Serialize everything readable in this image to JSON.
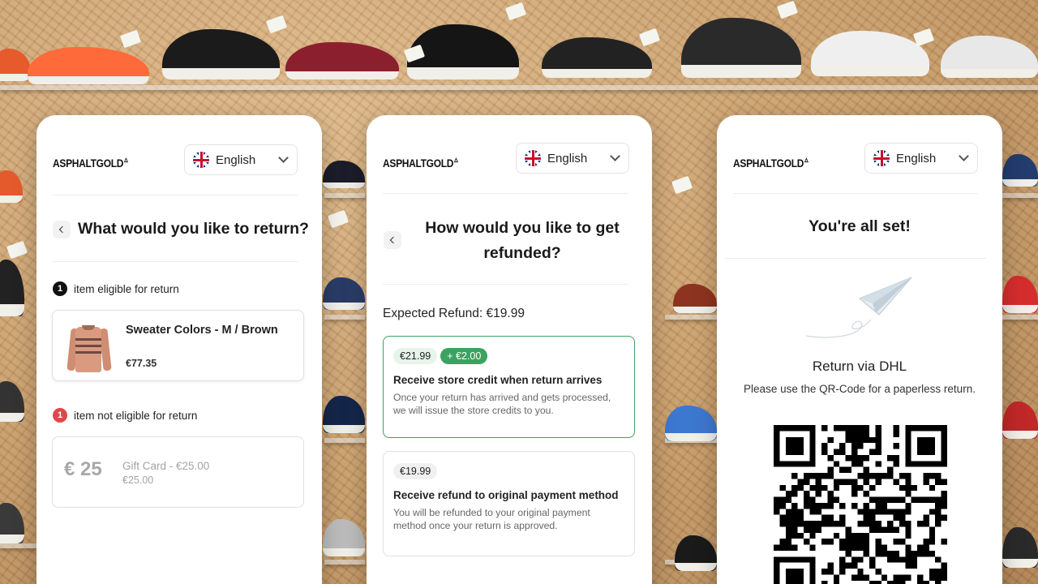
{
  "brand": {
    "logo_text": "ASPHALTGOLD",
    "logo_mark": "▵"
  },
  "language": {
    "selected": "English"
  },
  "card1": {
    "title": "What would you like to return?",
    "eligible": {
      "count": "1",
      "label": "item eligible for return",
      "badge_color": "#111111",
      "item": {
        "name": "Sweater Colors - M / Brown",
        "price": "€77.35"
      }
    },
    "not_eligible": {
      "count": "1",
      "label": "item not eligible for return",
      "badge_color": "#e0474c",
      "item": {
        "thumb_text": "€ 25",
        "name": "Gift Card - €25.00",
        "price": "€25.00"
      }
    }
  },
  "card2": {
    "title": "How would you like to get refunded?",
    "expected_refund": "Expected Refund: €19.99",
    "options": [
      {
        "amount": "€21.99",
        "bonus": "+ €2.00",
        "title": "Receive store credit when return arrives",
        "description": "Once your return has arrived and gets processed, we will issue the store credits to you.",
        "selected": true
      },
      {
        "amount": "€19.99",
        "title": "Receive refund to original payment method",
        "description": "You will be refunded to your original payment method once your return is approved.",
        "selected": false
      }
    ],
    "accent_color": "#3aa35f"
  },
  "card3": {
    "title": "You're all set!",
    "carrier_title": "Return via DHL",
    "carrier_subtitle": "Please use the QR-Code for a paperless return.",
    "illustration": "paper-plane-icon",
    "qr_code": "qr-code"
  }
}
